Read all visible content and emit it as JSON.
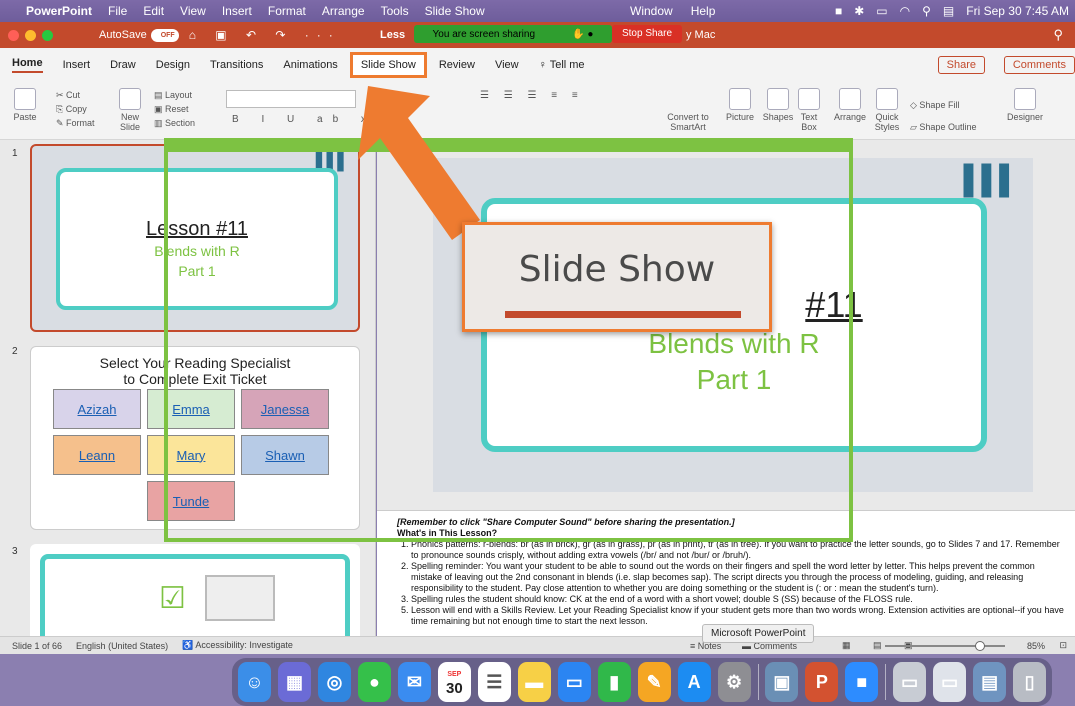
{
  "menubar": {
    "items": [
      "PowerPoint",
      "File",
      "Edit",
      "View",
      "Insert",
      "Format",
      "Arrange",
      "Tools",
      "Slide Show"
    ],
    "right_items": [
      "Window",
      "Help"
    ],
    "datetime": "Fri Sep 30  7:45 AM"
  },
  "titlebar": {
    "autosave_label": "AutoSave",
    "autosave_state": "OFF",
    "doc_title_left": "Less",
    "share_banner": "You are screen sharing",
    "stop_share": "Stop Share",
    "doc_title_right": "y Mac"
  },
  "ribbon_tabs": [
    "Home",
    "Insert",
    "Draw",
    "Design",
    "Transitions",
    "Animations",
    "Slide Show",
    "Review",
    "View",
    "Tell me"
  ],
  "ribbon_actions": {
    "share": "Share",
    "comments": "Comments"
  },
  "ribbon": {
    "paste": "Paste",
    "cut": "Cut",
    "copy": "Copy",
    "format": "Format",
    "new_slide": "New Slide",
    "layout": "Layout",
    "reset": "Reset",
    "section": "Section",
    "convert": "Convert to SmartArt",
    "picture": "Picture",
    "shapes": "Shapes",
    "text_box": "Text Box",
    "arrange": "Arrange",
    "quick_styles": "Quick Styles",
    "shape_fill": "Shape Fill",
    "shape_outline": "Shape Outline",
    "designer": "Designer"
  },
  "thumbnails": {
    "slide1": {
      "number": "1",
      "title": "Lesson #11",
      "sub1": "Blends with R",
      "sub2": "Part 1"
    },
    "slide2": {
      "number": "2",
      "title1": "Select Your Reading Specialist",
      "title2": "to Complete Exit Ticket",
      "names": [
        "Azizah",
        "Emma",
        "Janessa",
        "Leann",
        "Mary",
        "Shawn",
        "Tunde"
      ]
    },
    "slide3": {
      "number": "3"
    }
  },
  "slide": {
    "title": "#11",
    "sub1": "Blends with R",
    "sub2": "Part 1"
  },
  "notes": {
    "line1": "[Remember to click \"Share Computer Sound\" before sharing the presentation.]",
    "heading": "What's in This Lesson?",
    "items": [
      "1. Phonics patterns: r-blends: br (as in brick), gr (as in grass), pr (as in print), tr (as in tree). If you want to practice the letter sounds, go to Slides 7 and 17. Remember to pronounce sounds crisply, without adding extra vowels (/br/ and not /bur/ or /bruh/).",
      "2. Spelling reminder: You want your student to be able to sound out the words on their fingers and spell the word letter by letter. This helps prevent the common mistake of leaving out the 2nd consonant in blends (i.e. slap becomes sap). The script directs you through the process of modeling, guiding, and releasing responsibility to the student. Pay close attention to whether you are doing something or the student is (: or : mean the student's turn).",
      "3. Spelling rules the student should know: CK at the end of a word with a short vowel; double S (SS) because of the FLOSS rule.",
      "5. Lesson will end with a Skills Review. Let your Reading Specialist know if your student gets more than two words wrong. Extension activities are optional--if you have time remaining but not enough time to start the next lesson."
    ]
  },
  "status": {
    "slide_of": "Slide 1 of 66",
    "language": "English (United States)",
    "accessibility": "Accessibility: Investigate",
    "notes": "Notes",
    "comments": "Comments",
    "zoom": "85%"
  },
  "tooltip": "Microsoft PowerPoint",
  "callout": {
    "text": "Slide Show"
  },
  "dock": {
    "calendar_month": "SEP",
    "calendar_day": "30"
  },
  "colors": {
    "accent": "#c34a2c",
    "highlight": "#ee7b30",
    "teal": "#4ecdc4",
    "green": "#7dc242"
  }
}
